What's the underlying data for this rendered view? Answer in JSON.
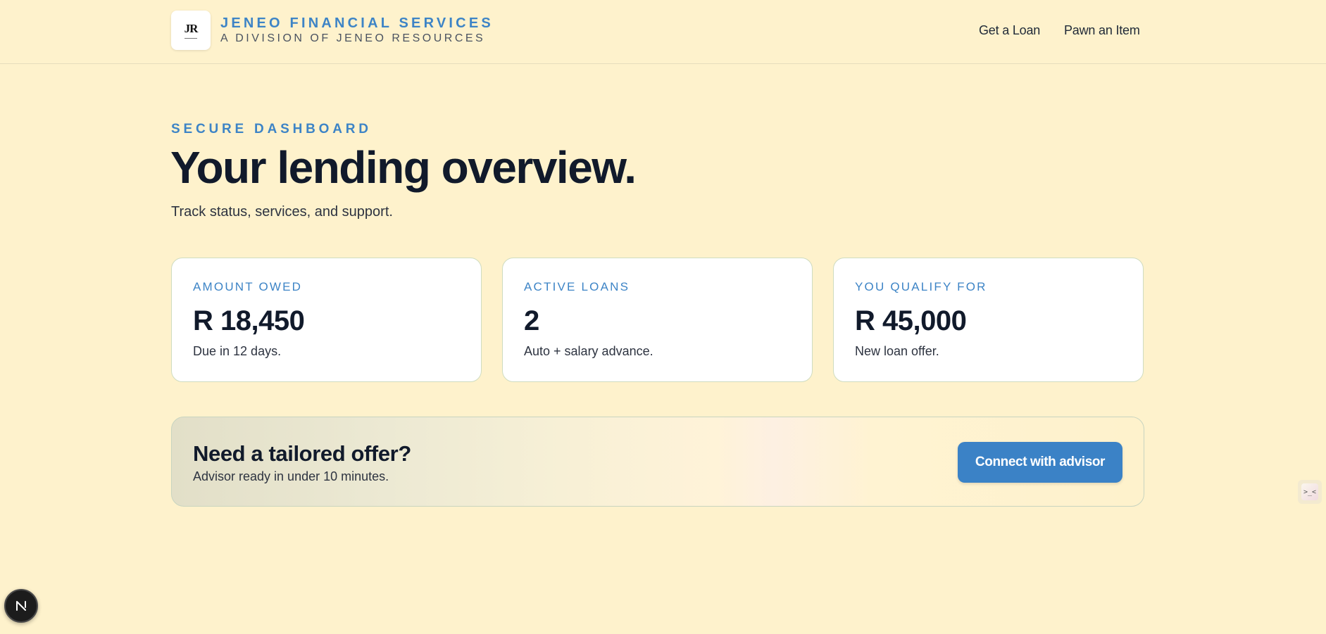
{
  "header": {
    "logo_text": "JR",
    "brand_name": "JENEO FINANCIAL SERVICES",
    "brand_sub": "A DIVISION OF JENEO RESOURCES",
    "nav": [
      {
        "label": "Get a Loan"
      },
      {
        "label": "Pawn an Item"
      }
    ]
  },
  "hero": {
    "eyebrow": "SECURE DASHBOARD",
    "title": "Your lending overview.",
    "subtitle": "Track status, services, and support."
  },
  "stats": [
    {
      "label": "AMOUNT OWED",
      "value": "R 18,450",
      "note": "Due in 12 days."
    },
    {
      "label": "ACTIVE LOANS",
      "value": "2",
      "note": "Auto + salary advance."
    },
    {
      "label": "YOU QUALIFY FOR",
      "value": "R 45,000",
      "note": "New loan offer."
    }
  ],
  "offer": {
    "title": "Need a tailored offer?",
    "subtitle": "Advisor ready in under 10 minutes.",
    "button_label": "Connect with advisor"
  },
  "widgets": {
    "side_widget_icon": "chat-face-icon",
    "side_widget_glyph": ">_<",
    "dev_badge_icon": "n-logo-icon"
  },
  "colors": {
    "background": "#fef2cc",
    "accent": "#3d84c6",
    "button": "#3b82c6",
    "text": "#111a2b"
  }
}
